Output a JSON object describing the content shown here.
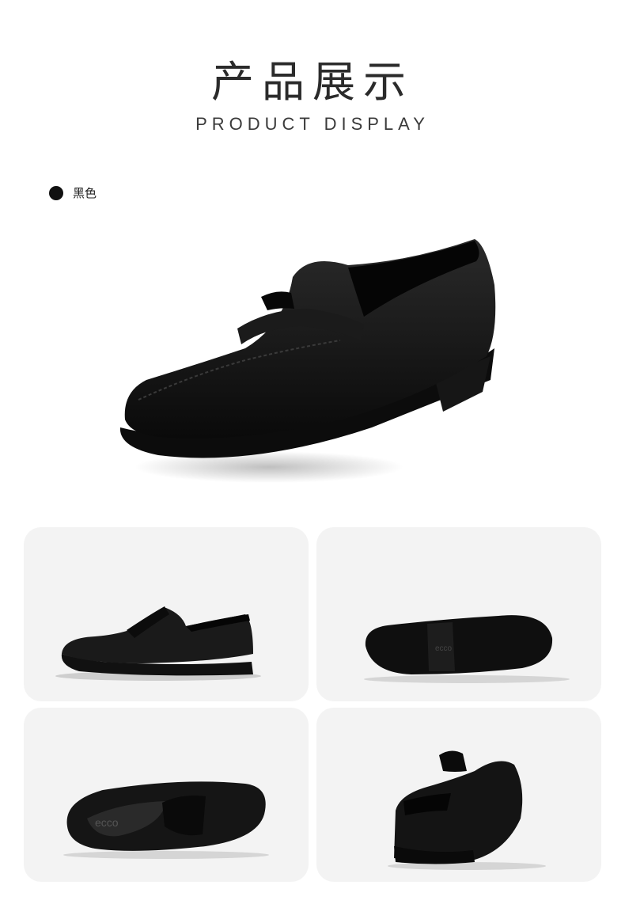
{
  "header": {
    "title_cn": "产品展示",
    "title_en": "PRODUCT DISPLAY"
  },
  "color_option": {
    "label": "黑色",
    "swatch_color": "#111111"
  },
  "images": {
    "hero": "black-penny-loafer-three-quarter",
    "gallery": [
      "side-view",
      "sole-view",
      "top-view",
      "rear-view"
    ]
  },
  "brand_mark": "ecco"
}
